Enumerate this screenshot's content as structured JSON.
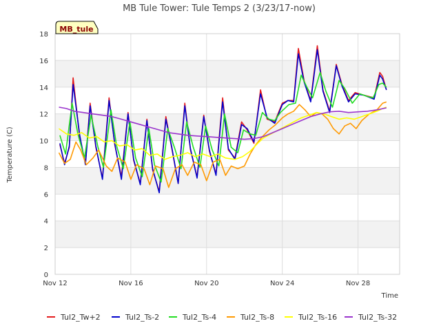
{
  "chart_data": {
    "type": "line",
    "title": "MB Tule Tower: Tule Temps 2 (3/23/17-now)",
    "xlabel": "Time",
    "ylabel": "Temperature (C)",
    "badge": "MB_tule",
    "ylim": [
      0,
      18
    ],
    "xlim": [
      12,
      30.2
    ],
    "yticks": [
      0,
      2,
      4,
      6,
      8,
      10,
      12,
      14,
      16,
      18
    ],
    "xticks": [
      {
        "v": 12,
        "label": "Nov 12"
      },
      {
        "v": 16,
        "label": "Nov 16"
      },
      {
        "v": 20,
        "label": "Nov 20"
      },
      {
        "v": 24,
        "label": "Nov 24"
      },
      {
        "v": 28,
        "label": "Nov 28"
      }
    ],
    "grid": true,
    "legend_position": "bottom",
    "series": [
      {
        "name": "Tul2_Tw+2",
        "color": "#e41a1c",
        "x": [
          12.25,
          12.5,
          12.75,
          12.95,
          13.3,
          13.6,
          13.85,
          14.15,
          14.5,
          14.85,
          15.15,
          15.5,
          15.85,
          16.15,
          16.5,
          16.85,
          17.15,
          17.5,
          17.85,
          18.15,
          18.5,
          18.85,
          19.15,
          19.5,
          19.85,
          20.15,
          20.5,
          20.85,
          21.15,
          21.5,
          21.85,
          22.15,
          22.5,
          22.85,
          23.2,
          23.6,
          24,
          24.3,
          24.6,
          24.85,
          25.15,
          25.5,
          25.85,
          26.15,
          26.5,
          26.85,
          27.15,
          27.5,
          27.85,
          28.3,
          28.85,
          29.15,
          29.3,
          29.5
        ],
        "y": [
          9.7,
          8.3,
          9.5,
          14.7,
          10.2,
          8.3,
          12.8,
          9.5,
          7.2,
          13.2,
          9.7,
          7.3,
          12.1,
          8.5,
          6.8,
          11.6,
          7.8,
          6.2,
          11.8,
          9.5,
          6.8,
          12.8,
          9.3,
          7.3,
          11.9,
          9.2,
          7.5,
          13.2,
          9.3,
          8.7,
          11.4,
          10.8,
          9.8,
          13.8,
          11.6,
          11.4,
          12.8,
          13,
          13,
          16.9,
          14.5,
          13,
          17.1,
          13.8,
          12.2,
          15.7,
          14.2,
          13,
          13.6,
          13.4,
          13.2,
          15.1,
          14.8,
          13.8
        ]
      },
      {
        "name": "Tul2_Ts-2",
        "color": "#0000cc",
        "x": [
          12.25,
          12.5,
          12.75,
          12.95,
          13.3,
          13.6,
          13.85,
          14.15,
          14.5,
          14.85,
          15.15,
          15.5,
          15.85,
          16.15,
          16.5,
          16.85,
          17.15,
          17.5,
          17.85,
          18.15,
          18.5,
          18.85,
          19.15,
          19.5,
          19.85,
          20.15,
          20.5,
          20.85,
          21.15,
          21.5,
          21.85,
          22.15,
          22.5,
          22.85,
          23.2,
          23.6,
          24,
          24.3,
          24.6,
          24.85,
          25.15,
          25.5,
          25.85,
          26.15,
          26.5,
          26.85,
          27.15,
          27.5,
          27.85,
          28.3,
          28.85,
          29.15,
          29.3,
          29.5
        ],
        "y": [
          9.8,
          8.2,
          9.6,
          14.2,
          10.4,
          8.2,
          12.6,
          9.6,
          7.1,
          13,
          9.8,
          7.1,
          12,
          8.6,
          6.7,
          11.5,
          7.9,
          6.1,
          11.6,
          9.6,
          6.8,
          12.6,
          9.4,
          7.2,
          11.8,
          9.3,
          7.4,
          12.9,
          9.4,
          8.6,
          11.2,
          10.9,
          9.9,
          13.5,
          11.7,
          11.3,
          12.7,
          13,
          12.9,
          16.5,
          14.4,
          12.9,
          16.8,
          13.7,
          12.1,
          15.6,
          14.1,
          12.9,
          13.5,
          13.4,
          13.1,
          14.9,
          14.6,
          13.8
        ]
      },
      {
        "name": "Tul2_Ts-4",
        "color": "#22dd22",
        "x": [
          12.25,
          12.55,
          12.9,
          13.2,
          13.55,
          13.9,
          14.25,
          14.55,
          14.95,
          15.25,
          15.6,
          15.95,
          16.25,
          16.6,
          16.95,
          17.25,
          17.6,
          17.95,
          18.3,
          18.65,
          18.95,
          19.3,
          19.65,
          19.95,
          20.3,
          20.65,
          20.95,
          21.3,
          21.65,
          21.95,
          22.3,
          22.6,
          22.95,
          23.3,
          23.6,
          23.9,
          24.35,
          24.7,
          25,
          25.3,
          25.6,
          26,
          26.3,
          26.65,
          27,
          27.3,
          27.7,
          28.1,
          28.5,
          28.8,
          29.1,
          29.3,
          29.5
        ],
        "y": [
          10.4,
          9,
          12.8,
          10.5,
          8.7,
          11.9,
          9.6,
          8,
          12.3,
          9.6,
          7.9,
          11.4,
          8.7,
          7.3,
          10.9,
          8.2,
          6.9,
          10.9,
          9.5,
          7.9,
          11.4,
          9.5,
          8,
          11.1,
          9.3,
          8.1,
          12,
          9.5,
          9.1,
          10.8,
          10.5,
          10.4,
          12.1,
          11.6,
          11.5,
          12.1,
          12.7,
          12.8,
          14.9,
          14,
          13.2,
          15.1,
          13.7,
          12.5,
          14.5,
          13.9,
          12.8,
          13.5,
          13.3,
          13.2,
          14.2,
          14.3,
          14
        ]
      },
      {
        "name": "Tul2_Ts-8",
        "color": "#ff9900",
        "x": [
          12.2,
          12.5,
          12.8,
          13.1,
          13.35,
          13.65,
          14,
          14.3,
          14.7,
          15,
          15.3,
          15.7,
          16,
          16.3,
          16.7,
          17,
          17.3,
          17.7,
          18,
          18.35,
          18.7,
          19,
          19.35,
          19.7,
          20,
          20.35,
          20.7,
          21,
          21.3,
          21.65,
          22,
          22.3,
          22.6,
          22.95,
          23.3,
          23.65,
          24,
          24.3,
          24.6,
          24.9,
          25.2,
          25.5,
          25.8,
          26.1,
          26.4,
          26.7,
          27,
          27.3,
          27.6,
          27.9,
          28.2,
          28.6,
          29,
          29.3,
          29.5
        ],
        "y": [
          9.1,
          8.3,
          8.6,
          9.9,
          9.3,
          8.2,
          8.7,
          9.3,
          8.1,
          7.7,
          8.7,
          8.4,
          7.1,
          8.2,
          7.9,
          6.7,
          8.1,
          7.9,
          6.5,
          7.9,
          8.2,
          7.4,
          8.4,
          8.2,
          7,
          8.4,
          8.6,
          7.4,
          8.1,
          7.9,
          8.1,
          9,
          9.7,
          10.3,
          10.8,
          11.2,
          11.7,
          12,
          12.2,
          12.7,
          12.3,
          11.8,
          12.1,
          12,
          11.6,
          10.9,
          10.5,
          11.1,
          11.3,
          10.9,
          11.5,
          12,
          12.3,
          12.8,
          12.9
        ]
      },
      {
        "name": "Tul2_Ts-16",
        "color": "#ffff00",
        "x": [
          12.2,
          12.6,
          13,
          13.4,
          13.8,
          14.2,
          14.6,
          15,
          15.4,
          15.8,
          16.2,
          16.6,
          17,
          17.4,
          17.8,
          18.2,
          18.6,
          19,
          19.4,
          19.8,
          20.2,
          20.6,
          21,
          21.5,
          21.9,
          22.3,
          22.7,
          23,
          23.4,
          23.8,
          24.2,
          24.6,
          25,
          25.4,
          25.8,
          26.2,
          26.6,
          27,
          27.4,
          27.8,
          28.2,
          28.6,
          29,
          29.3,
          29.5
        ],
        "y": [
          10.9,
          10.5,
          10.4,
          10.6,
          10.2,
          10.3,
          9.9,
          10,
          9.6,
          9.7,
          9.3,
          9.4,
          8.9,
          9,
          8.6,
          8.8,
          8.9,
          9.1,
          8.8,
          9,
          8.8,
          9,
          8.7,
          8.6,
          8.8,
          9.2,
          9.8,
          10.2,
          10.5,
          10.8,
          11.1,
          11.4,
          11.7,
          11.9,
          12.1,
          12,
          11.8,
          11.6,
          11.7,
          11.6,
          11.8,
          12,
          12.2,
          12.4,
          12.5
        ]
      },
      {
        "name": "Tul2_Ts-32",
        "color": "#9933cc",
        "x": [
          12.2,
          12.6,
          13,
          13.5,
          14,
          14.5,
          15,
          15.5,
          16,
          16.5,
          17,
          17.5,
          18,
          18.5,
          19,
          19.5,
          20,
          20.5,
          21,
          21.5,
          22,
          22.5,
          23,
          23.5,
          24,
          24.5,
          25,
          25.5,
          26,
          26.5,
          27,
          27.5,
          28,
          28.5,
          29,
          29.5
        ],
        "y": [
          12.5,
          12.4,
          12.2,
          12.1,
          12,
          11.9,
          11.8,
          11.6,
          11.4,
          11.2,
          11,
          10.8,
          10.6,
          10.5,
          10.4,
          10.35,
          10.3,
          10.25,
          10.2,
          10.15,
          10.1,
          10.15,
          10.3,
          10.6,
          10.9,
          11.2,
          11.5,
          11.8,
          12,
          12.15,
          12.2,
          12.1,
          12.15,
          12.2,
          12.3,
          12.45
        ]
      }
    ]
  }
}
